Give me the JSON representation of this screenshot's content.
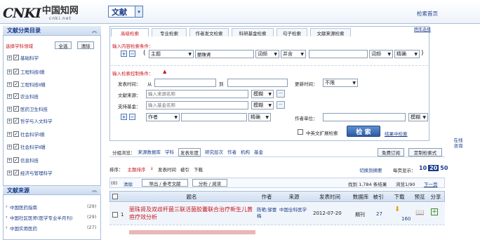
{
  "header": {
    "logo_text": "CNKI",
    "logo_cn": "中国知网",
    "logo_url": "cnki.net",
    "db_select": "文献",
    "home_link": "检索首页"
  },
  "sidebar": {
    "title": "文献分类目录",
    "select_label": "选择学科领域",
    "select_all": "全选",
    "clear": "清除",
    "categories": [
      {
        "label": "基础科学"
      },
      {
        "label": "工程科技Ⅰ辑"
      },
      {
        "label": "工程科技Ⅱ辑"
      },
      {
        "label": "农业科技"
      },
      {
        "label": "医药卫生科技"
      },
      {
        "label": "哲学与人文科学"
      },
      {
        "label": "社会科学Ⅰ辑"
      },
      {
        "label": "社会科学Ⅱ辑"
      },
      {
        "label": "信息科技"
      },
      {
        "label": "经济与管理科学"
      }
    ],
    "source_title": "文献来源",
    "sources": [
      {
        "label": "中国医药指南",
        "count": "(29)"
      },
      {
        "label": "中国社区医师(医学专业半月刊)",
        "count": "(29)"
      },
      {
        "label": "中国实用医药",
        "count": "(27)"
      }
    ]
  },
  "search": {
    "tabs": [
      "高级检索",
      "专业检索",
      "作者发文检索",
      "科研基金检索",
      "句子检索",
      "文献来源检索"
    ],
    "active_tab": "高级检索",
    "switch_link": "跨库选择",
    "content_title": "输入内容检索条件：",
    "row1": {
      "field": "主题",
      "value": "丽珠肾",
      "freq1": "词频",
      "logic": "并含",
      "value2": "",
      "freq2": "词频",
      "match": "精确"
    },
    "control_title": "输入检索控制条件：",
    "pub_time_label": "发表时间：",
    "from": "从",
    "to": "到",
    "update_label": "更新时间：",
    "update_value": "不限",
    "source_label": "文献来源：",
    "source_ph": "输入来源名称",
    "fund_label": "支持基金：",
    "fund_ph": "输入基金名称",
    "fuzzy": "模糊",
    "author_sel": "作者",
    "precise": "精确",
    "author_unit_label": "作者单位：",
    "fuzzy2": "模糊",
    "cn_en_ext": "中英文扩展检索",
    "search_btn": "检 索",
    "result_search": "结果中检索",
    "side_text": "在线咨询"
  },
  "results": {
    "group_label": "分组浏览：",
    "groups": [
      "来源数据库",
      "学科",
      "发表年度",
      "研究层次",
      "作者",
      "机构",
      "基金"
    ],
    "active_group": "发表年度",
    "free_sub": "免费订阅",
    "custom": "定制检索式",
    "sort_label": "排序：",
    "sort_options": [
      "主题排序",
      "发表时间",
      "被引",
      "下载"
    ],
    "sort_active": "主题排序",
    "view_switch": "切换到摘要",
    "per_page_label": "每页显示：",
    "per_page": [
      "10",
      "20",
      "50"
    ],
    "per_page_active": "20",
    "count_text": "(0)",
    "clear": "清除",
    "export": "导出 / 参考文献",
    "analysis": "分析 / 阅读",
    "found": "找到 1,784 条结果",
    "pages": "浏览1/90",
    "next": "下一页",
    "columns": [
      "题名",
      "作者",
      "来源",
      "发表时间",
      "数据库",
      "被引",
      "下载",
      "预览",
      "分享"
    ],
    "rows": [
      {
        "num": "1",
        "title": "丽珠肾及双歧杆菌三联活菌胶囊联合治疗新生儿黄疸疗效分析",
        "author": "陈艳;邹壹梅",
        "source": "中国全科医学",
        "date": "2012-07-20",
        "db": "期刊",
        "cited": "27",
        "downloads": "160"
      }
    ]
  },
  "colors": {
    "accent": "#1a3c8a",
    "red": "#c8161d",
    "header_blue": "#3a6ea5",
    "row_alt": "#f0f5fb"
  }
}
